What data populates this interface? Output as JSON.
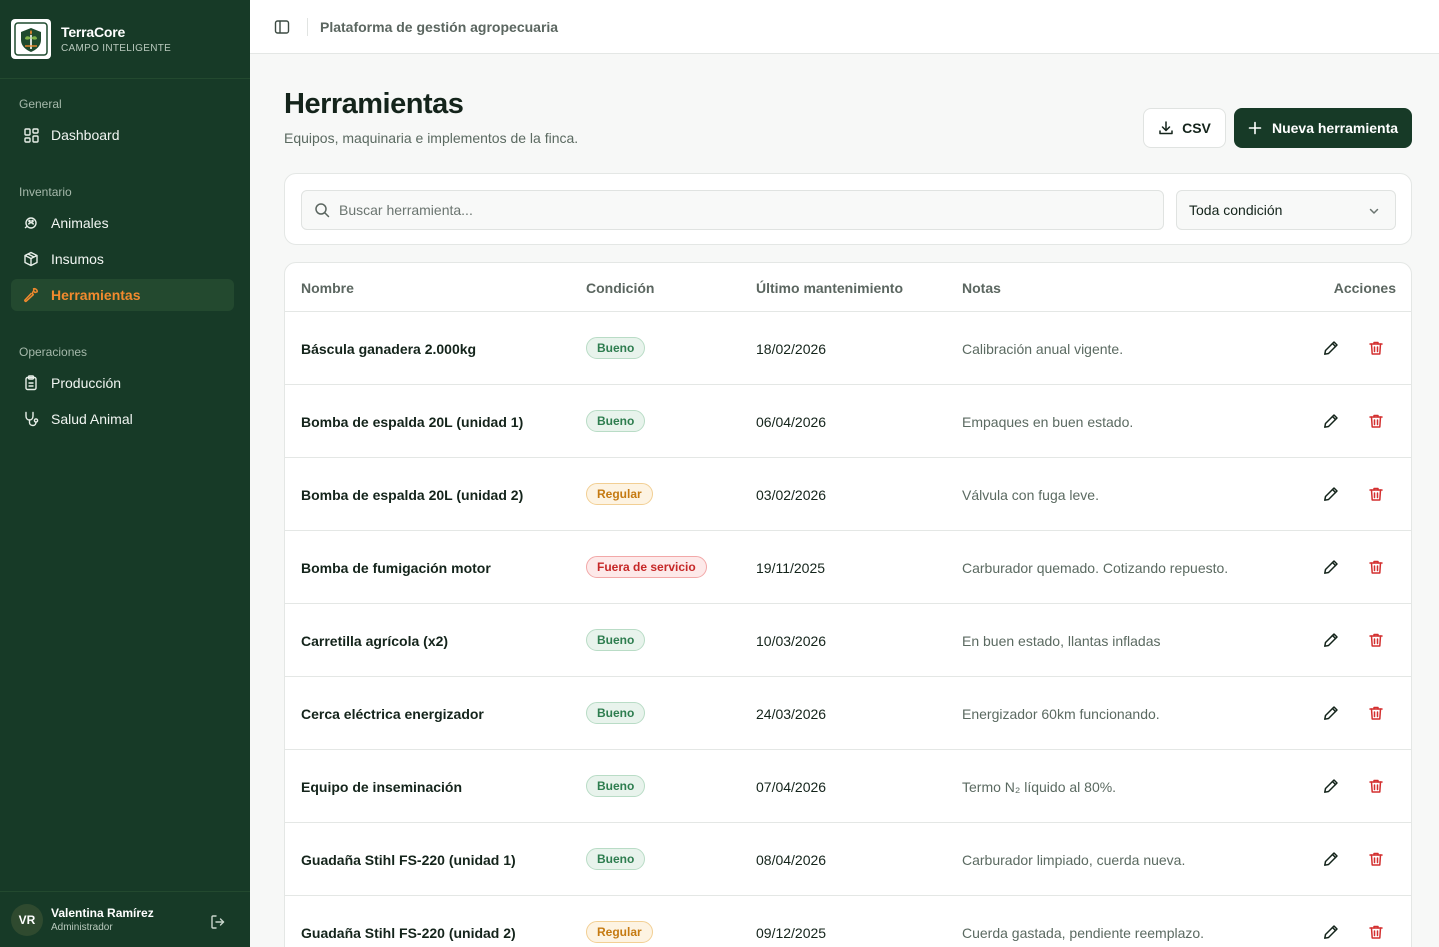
{
  "brand": {
    "name": "TerraCore",
    "subtitle": "CAMPO INTELIGENTE"
  },
  "sidebar": {
    "sections": [
      {
        "label": "General",
        "items": [
          {
            "label": "Dashboard",
            "icon": "dashboard-icon"
          }
        ]
      },
      {
        "label": "Inventario",
        "items": [
          {
            "label": "Animales",
            "icon": "paw-icon"
          },
          {
            "label": "Insumos",
            "icon": "box-icon"
          },
          {
            "label": "Herramientas",
            "icon": "wrench-icon",
            "active": true
          }
        ]
      },
      {
        "label": "Operaciones",
        "items": [
          {
            "label": "Producción",
            "icon": "clipboard-icon"
          },
          {
            "label": "Salud Animal",
            "icon": "stethoscope-icon"
          }
        ]
      }
    ]
  },
  "user": {
    "initials": "VR",
    "name": "Valentina Ramírez",
    "role": "Administrador"
  },
  "topbar": {
    "title": "Plataforma de gestión agropecuaria"
  },
  "header": {
    "title": "Herramientas",
    "subtitle": "Equipos, maquinaria e implementos de la finca.",
    "csv_label": "CSV",
    "new_label": "Nueva herramienta"
  },
  "filters": {
    "search_placeholder": "Buscar herramienta...",
    "condition_value": "Toda condición"
  },
  "table": {
    "columns": {
      "name": "Nombre",
      "condition": "Condición",
      "maintenance": "Último mantenimiento",
      "notes": "Notas",
      "actions": "Acciones"
    },
    "rows": [
      {
        "name": "Báscula ganadera 2.000kg",
        "condition": "Bueno",
        "status": "bueno",
        "date": "18/02/2026",
        "notes": "Calibración anual vigente."
      },
      {
        "name": "Bomba de espalda 20L (unidad 1)",
        "condition": "Bueno",
        "status": "bueno",
        "date": "06/04/2026",
        "notes": "Empaques en buen estado."
      },
      {
        "name": "Bomba de espalda 20L (unidad 2)",
        "condition": "Regular",
        "status": "regular",
        "date": "03/02/2026",
        "notes": "Válvula con fuga leve."
      },
      {
        "name": "Bomba de fumigación motor",
        "condition": "Fuera de servicio",
        "status": "fuera",
        "date": "19/11/2025",
        "notes": "Carburador quemado. Cotizando repuesto."
      },
      {
        "name": "Carretilla agrícola (x2)",
        "condition": "Bueno",
        "status": "bueno",
        "date": "10/03/2026",
        "notes": "En buen estado, llantas infladas"
      },
      {
        "name": "Cerca eléctrica energizador",
        "condition": "Bueno",
        "status": "bueno",
        "date": "24/03/2026",
        "notes": "Energizador 60km funcionando."
      },
      {
        "name": "Equipo de inseminación",
        "condition": "Bueno",
        "status": "bueno",
        "date": "07/04/2026",
        "notes": "Termo N₂ líquido al 80%."
      },
      {
        "name": "Guadaña Stihl FS-220 (unidad 1)",
        "condition": "Bueno",
        "status": "bueno",
        "date": "08/04/2026",
        "notes": "Carburador limpiado, cuerda nueva."
      },
      {
        "name": "Guadaña Stihl FS-220 (unidad 2)",
        "condition": "Regular",
        "status": "regular",
        "date": "09/12/2025",
        "notes": "Cuerda gastada, pendiente reemplazo."
      }
    ]
  },
  "colors": {
    "sidebar_bg": "#173a27",
    "accent": "#f28a2e",
    "primary": "#173a27",
    "danger": "#d32f2f"
  }
}
